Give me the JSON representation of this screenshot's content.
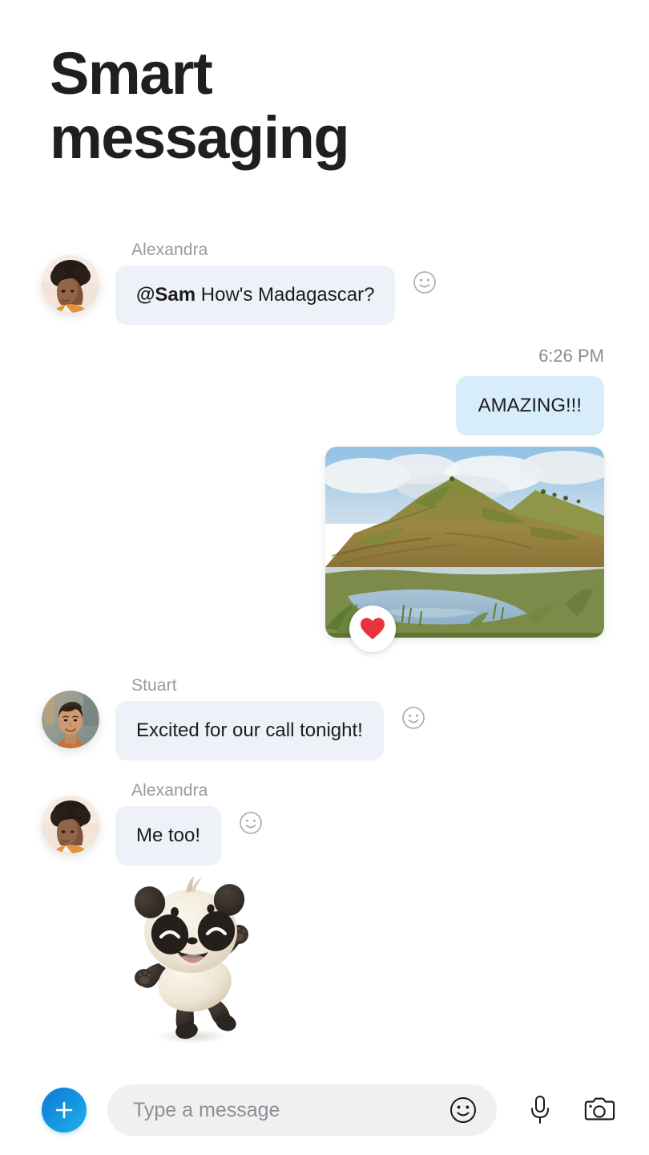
{
  "headline": {
    "line1": "Smart",
    "line2": "messaging"
  },
  "colors": {
    "incoming_bubble": "#eef1f7",
    "outgoing_bubble": "#d8edfa",
    "accent_blue": "#1697e0",
    "heart_red": "#e8323c",
    "sender_name": "#9a9a9e",
    "timestamp": "#8c8c90",
    "text": "#1c1c1e",
    "input_background": "#f0f0f2",
    "placeholder": "#8e8e93"
  },
  "conversation": {
    "messages": [
      {
        "id": "msg-1",
        "type": "text-incoming",
        "sender": "Alexandra",
        "avatar_name": "avatar-alexandra",
        "mention": "@Sam",
        "text": " How's Madagascar?",
        "reaction_icon": "smiley-outline-icon"
      },
      {
        "id": "msg-2",
        "type": "text-outgoing",
        "timestamp": "6:26 PM",
        "text": "AMAZING!!!"
      },
      {
        "id": "msg-3",
        "type": "photo-outgoing",
        "photo_name": "madagascar-landscape-photo",
        "photo_description": "Green and brown hillside above a wetland lake",
        "reaction_icon": "heart-icon"
      },
      {
        "id": "msg-4",
        "type": "text-incoming",
        "sender": "Stuart",
        "avatar_name": "avatar-stuart",
        "text": "Excited for our call tonight!",
        "reaction_icon": "smiley-outline-icon"
      },
      {
        "id": "msg-5",
        "type": "text-incoming",
        "sender": "Alexandra",
        "avatar_name": "avatar-alexandra",
        "text": "Me too!",
        "reaction_icon": "smiley-outline-icon"
      },
      {
        "id": "msg-6",
        "type": "sticker",
        "sticker_name": "dancing-panda-sticker"
      }
    ]
  },
  "composer": {
    "add_button_icon": "plus-icon",
    "placeholder": "Type a message",
    "value": "",
    "emoji_icon": "smiley-icon",
    "mic_icon": "microphone-icon",
    "camera_icon": "camera-icon"
  }
}
